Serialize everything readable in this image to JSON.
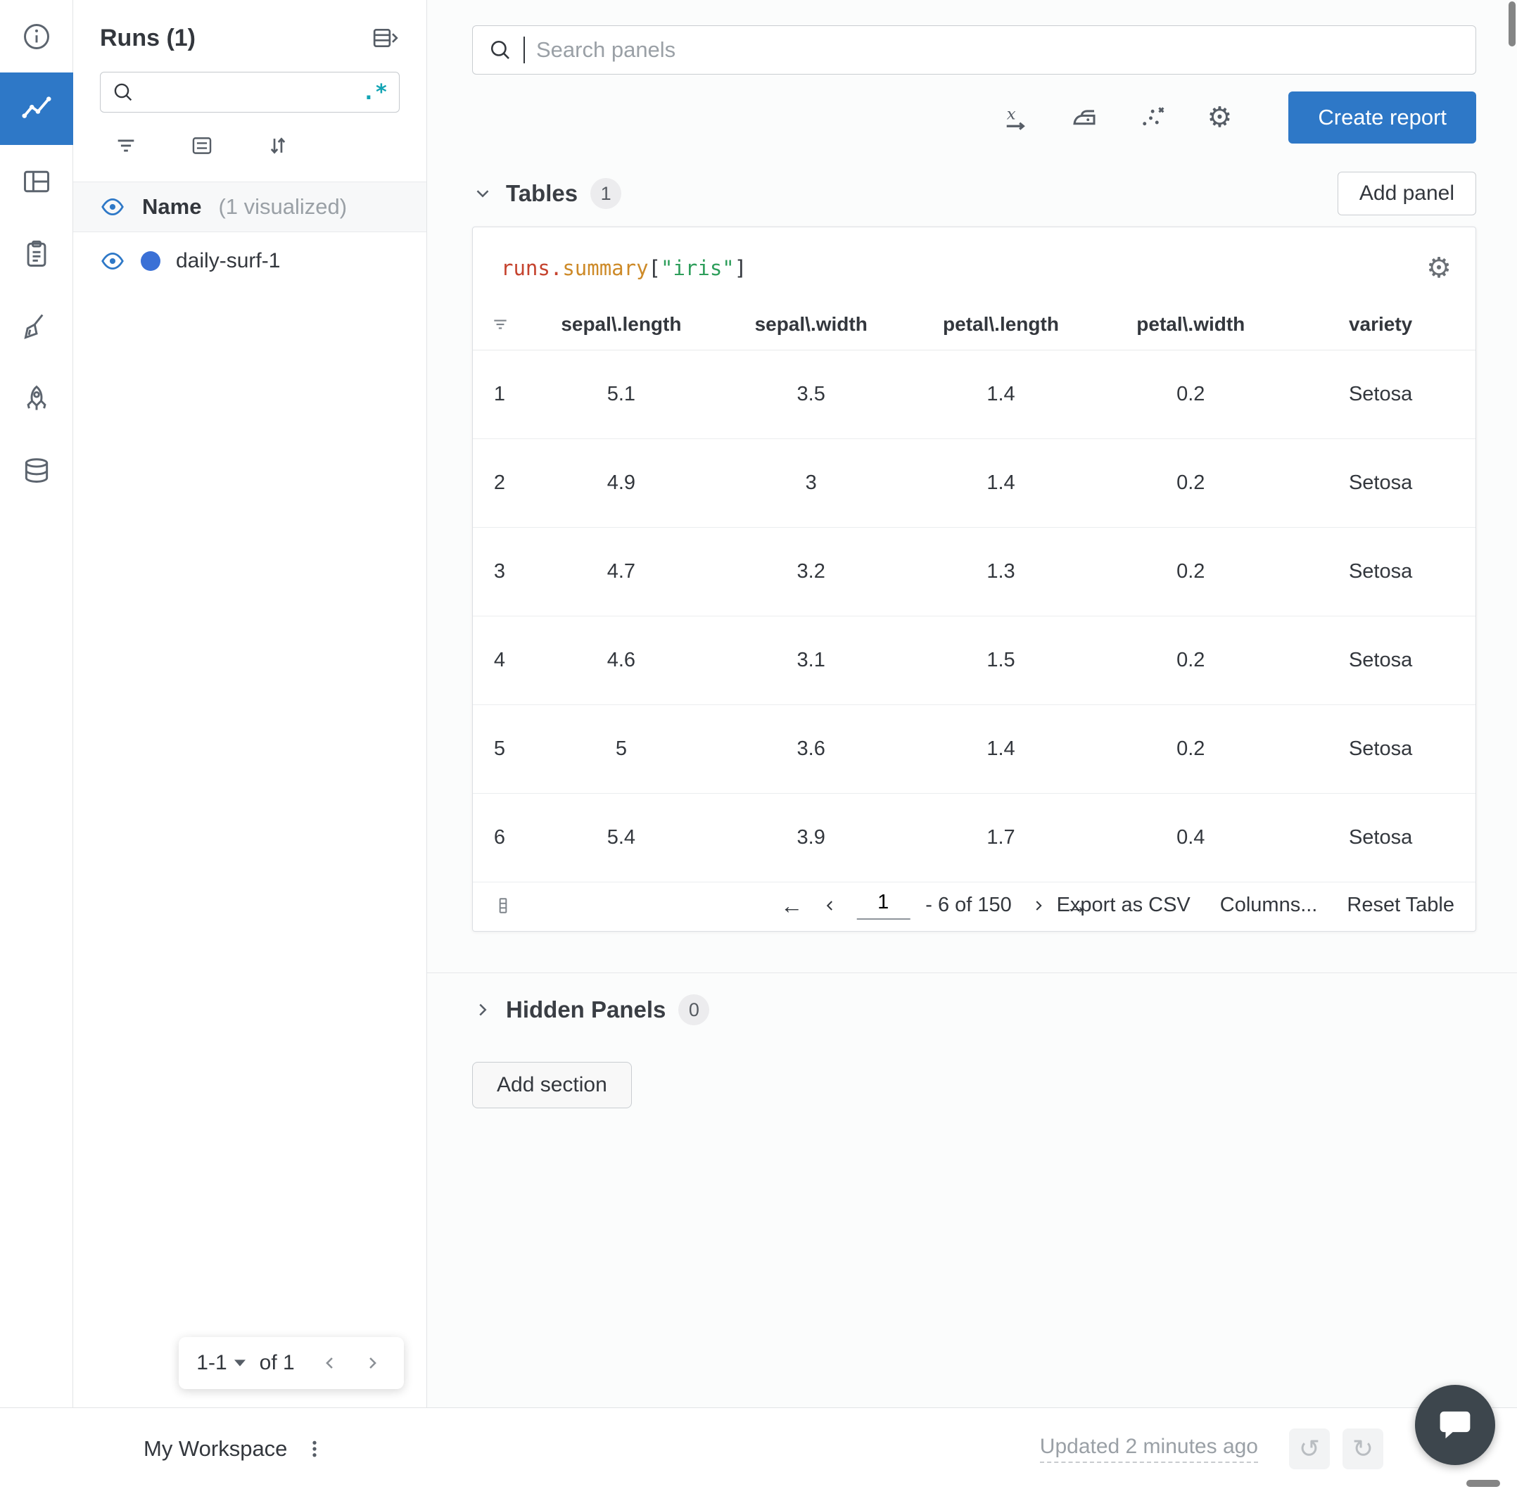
{
  "colors": {
    "accent_blue": "#2e78c7",
    "run_dot_blue": "#3a70d6",
    "regex_teal": "#12a4b4",
    "code_red": "#c5432e",
    "code_orange": "#cd8a28",
    "code_green": "#2e9e5b",
    "chat_fab_bg": "#3d464d"
  },
  "icon_rail": {
    "icons": [
      "info",
      "line-chart (active)",
      "panels",
      "clipboard",
      "broom",
      "rocket",
      "database"
    ]
  },
  "sidebar": {
    "title": "Runs (1)",
    "search": {
      "value": "",
      "regex_label": ".*"
    },
    "name_header": {
      "label": "Name",
      "suffix": "(1 visualized)"
    },
    "runs": [
      {
        "name": "daily-surf-1"
      }
    ],
    "pagination": {
      "range": "1-1",
      "of_label": "of 1"
    }
  },
  "toolbar": {
    "search_placeholder": "Search panels",
    "create_report_label": "Create report"
  },
  "sections": {
    "tables": {
      "title": "Tables",
      "count": "1",
      "add_panel_label": "Add panel"
    },
    "hidden": {
      "title": "Hidden Panels",
      "count": "0"
    },
    "add_section_label": "Add section"
  },
  "panel": {
    "code_title": {
      "obj": "runs",
      "dot": ".",
      "prop": "summary",
      "open": "[",
      "str": "\"iris\"",
      "close": "]"
    },
    "table": {
      "columns": [
        "sepal\\.length",
        "sepal\\.width",
        "petal\\.length",
        "petal\\.width",
        "variety"
      ],
      "rows": [
        {
          "idx": "1",
          "values": [
            "5.1",
            "3.5",
            "1.4",
            "0.2",
            "Setosa"
          ]
        },
        {
          "idx": "2",
          "values": [
            "4.9",
            "3",
            "1.4",
            "0.2",
            "Setosa"
          ]
        },
        {
          "idx": "3",
          "values": [
            "4.7",
            "3.2",
            "1.3",
            "0.2",
            "Setosa"
          ]
        },
        {
          "idx": "4",
          "values": [
            "4.6",
            "3.1",
            "1.5",
            "0.2",
            "Setosa"
          ]
        },
        {
          "idx": "5",
          "values": [
            "5",
            "3.6",
            "1.4",
            "0.2",
            "Setosa"
          ]
        },
        {
          "idx": "6",
          "values": [
            "5.4",
            "3.9",
            "1.7",
            "0.4",
            "Setosa"
          ]
        }
      ]
    },
    "footer": {
      "page_value": "1",
      "range_label": "- 6 of 150",
      "export_label": "Export as CSV",
      "columns_label": "Columns...",
      "reset_label": "Reset Table"
    }
  },
  "bottom_bar": {
    "workspace_label": "My Workspace",
    "updated_label": "Updated 2 minutes ago"
  }
}
